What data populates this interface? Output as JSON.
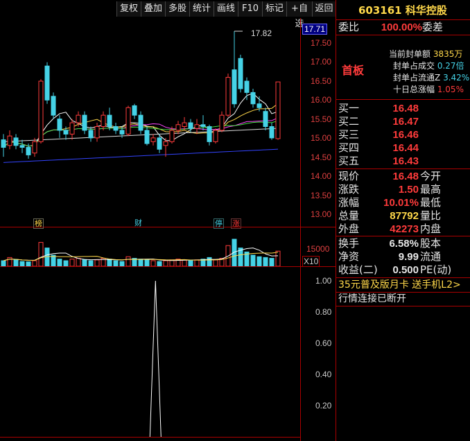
{
  "toolbar": {
    "buttons": [
      "复权",
      "叠加",
      "多股",
      "统计",
      "画线",
      "F10",
      "标记",
      "+自选",
      "返回"
    ]
  },
  "stock": {
    "code": "603161",
    "name": "科华控股",
    "ratio_label": "委比",
    "ratio_value": "100.00%",
    "diff_label": "委差"
  },
  "board": {
    "title": "首板",
    "seal_amount_label": "当前封单额",
    "seal_amount_value": "3835万",
    "seal_turnover_label": "封单占成交",
    "seal_turnover_value": "0.27倍",
    "seal_float_label": "封单占流通Z",
    "seal_float_value": "3.42%",
    "ten_day_label": "十日总涨幅",
    "ten_day_value": "1.05%"
  },
  "bids": [
    {
      "label": "买一",
      "price": "16.48"
    },
    {
      "label": "买二",
      "price": "16.47"
    },
    {
      "label": "买三",
      "price": "16.46"
    },
    {
      "label": "买四",
      "price": "16.44"
    },
    {
      "label": "买五",
      "price": "16.43"
    }
  ],
  "quote": [
    {
      "label": "现价",
      "value": "16.48",
      "label2": "今开"
    },
    {
      "label": "涨跌",
      "value": "1.50",
      "label2": "最高"
    },
    {
      "label": "涨幅",
      "value": "10.01%",
      "label2": "最低"
    },
    {
      "label": "总量",
      "value": "87792",
      "label2": "量比"
    },
    {
      "label": "外盘",
      "value": "42273",
      "label2": "内盘"
    }
  ],
  "stats": [
    {
      "label": "换手",
      "value": "6.58%",
      "label2": "股本"
    },
    {
      "label": "净资",
      "value": "9.99",
      "label2": "流通"
    },
    {
      "label": "收益(二)",
      "value": "0.500",
      "label2": "PE(动)"
    }
  ],
  "promo": "35元普及版月卡 送手机L2>",
  "status": "行情连接已断开",
  "price_axis": [
    "17.71",
    "17.50",
    "17.00",
    "16.50",
    "16.00",
    "15.50",
    "15.00",
    "14.50",
    "14.00",
    "13.50",
    "13.00"
  ],
  "peak_label": "17.82",
  "volume_axis": "15000",
  "volume_unit": "X10",
  "indicator_axis": [
    "1.00",
    "0.80",
    "0.60",
    "0.40",
    "0.20"
  ],
  "badges": [
    {
      "text": "榜",
      "color": "#ffd84a"
    },
    {
      "text": "财",
      "color": "#45d2e6"
    },
    {
      "text": "停",
      "color": "#45d2e6"
    },
    {
      "text": "涨",
      "color": "#ff3b3b"
    }
  ],
  "chart_data": {
    "type": "candlestick",
    "candles": [
      {
        "o": 14.95,
        "c": 14.75,
        "h": 15.1,
        "l": 14.5
      },
      {
        "o": 14.8,
        "c": 15.05,
        "h": 15.2,
        "l": 14.7
      },
      {
        "o": 15.0,
        "c": 14.8,
        "h": 15.1,
        "l": 14.7
      },
      {
        "o": 14.8,
        "c": 14.75,
        "h": 14.95,
        "l": 14.6
      },
      {
        "o": 14.75,
        "c": 14.55,
        "h": 14.85,
        "l": 14.45
      },
      {
        "o": 14.6,
        "c": 14.9,
        "h": 15.0,
        "l": 14.5
      },
      {
        "o": 14.9,
        "c": 16.5,
        "h": 16.55,
        "l": 14.85
      },
      {
        "o": 16.9,
        "c": 16.0,
        "h": 17.0,
        "l": 15.9
      },
      {
        "o": 16.1,
        "c": 15.6,
        "h": 16.2,
        "l": 15.5
      },
      {
        "o": 15.5,
        "c": 15.2,
        "h": 15.6,
        "l": 15.0
      },
      {
        "o": 15.2,
        "c": 15.1,
        "h": 15.3,
        "l": 14.95
      },
      {
        "o": 15.1,
        "c": 15.4,
        "h": 15.5,
        "l": 14.95
      },
      {
        "o": 15.4,
        "c": 15.6,
        "h": 15.7,
        "l": 15.3
      },
      {
        "o": 15.6,
        "c": 15.2,
        "h": 15.7,
        "l": 15.1
      },
      {
        "o": 15.2,
        "c": 15.0,
        "h": 15.3,
        "l": 14.9
      },
      {
        "o": 15.0,
        "c": 15.3,
        "h": 15.4,
        "l": 14.9
      },
      {
        "o": 15.3,
        "c": 15.6,
        "h": 15.7,
        "l": 15.2
      },
      {
        "o": 15.6,
        "c": 15.3,
        "h": 15.8,
        "l": 15.2
      },
      {
        "o": 15.3,
        "c": 15.2,
        "h": 15.4,
        "l": 15.1
      },
      {
        "o": 15.2,
        "c": 15.1,
        "h": 15.3,
        "l": 15.0
      },
      {
        "o": 15.1,
        "c": 15.8,
        "h": 15.85,
        "l": 15.05
      },
      {
        "o": 15.85,
        "c": 15.6,
        "h": 15.9,
        "l": 15.5
      },
      {
        "o": 15.6,
        "c": 15.2,
        "h": 15.7,
        "l": 15.1
      },
      {
        "o": 15.2,
        "c": 14.85,
        "h": 15.3,
        "l": 14.8
      },
      {
        "o": 14.9,
        "c": 15.0,
        "h": 15.1,
        "l": 14.8
      },
      {
        "o": 15.0,
        "c": 14.7,
        "h": 15.1,
        "l": 14.6
      },
      {
        "o": 14.8,
        "c": 14.9,
        "h": 15.0,
        "l": 14.5
      },
      {
        "o": 14.9,
        "c": 15.2,
        "h": 15.3,
        "l": 14.85
      },
      {
        "o": 15.2,
        "c": 15.35,
        "h": 15.45,
        "l": 15.1
      },
      {
        "o": 15.3,
        "c": 15.4,
        "h": 15.55,
        "l": 15.2
      },
      {
        "o": 15.4,
        "c": 15.25,
        "h": 15.5,
        "l": 15.15
      },
      {
        "o": 15.25,
        "c": 15.35,
        "h": 15.5,
        "l": 15.1
      },
      {
        "o": 15.35,
        "c": 15.3,
        "h": 15.6,
        "l": 15.2
      },
      {
        "o": 15.3,
        "c": 14.9,
        "h": 15.35,
        "l": 14.8
      },
      {
        "o": 14.9,
        "c": 15.2,
        "h": 15.25,
        "l": 14.85
      },
      {
        "o": 15.2,
        "c": 15.6,
        "h": 15.7,
        "l": 15.15
      },
      {
        "o": 15.6,
        "c": 16.6,
        "h": 16.7,
        "l": 15.55
      },
      {
        "o": 16.8,
        "c": 15.9,
        "h": 17.82,
        "l": 15.8
      },
      {
        "o": 17.1,
        "c": 16.3,
        "h": 17.2,
        "l": 16.2
      },
      {
        "o": 16.5,
        "c": 16.2,
        "h": 16.6,
        "l": 16.0
      },
      {
        "o": 16.2,
        "c": 15.9,
        "h": 16.3,
        "l": 15.8
      },
      {
        "o": 15.9,
        "c": 15.8,
        "h": 16.1,
        "l": 15.7
      },
      {
        "o": 15.7,
        "c": 15.3,
        "h": 15.8,
        "l": 15.2
      },
      {
        "o": 15.3,
        "c": 15.0,
        "h": 15.4,
        "l": 14.95
      },
      {
        "o": 14.98,
        "c": 16.48,
        "h": 16.48,
        "l": 14.95
      }
    ],
    "volumes": [
      35,
      55,
      40,
      30,
      28,
      35,
      150,
      115,
      70,
      45,
      35,
      45,
      50,
      40,
      35,
      40,
      50,
      45,
      35,
      30,
      60,
      50,
      45,
      40,
      35,
      30,
      35,
      40,
      45,
      40,
      35,
      40,
      45,
      55,
      40,
      50,
      130,
      170,
      115,
      90,
      70,
      60,
      55,
      50,
      95
    ],
    "ylim": [
      13.0,
      17.9
    ],
    "indicator": {
      "ylim": [
        0,
        1.0
      ],
      "spike_index": 23,
      "spike_value": 1.0
    }
  }
}
